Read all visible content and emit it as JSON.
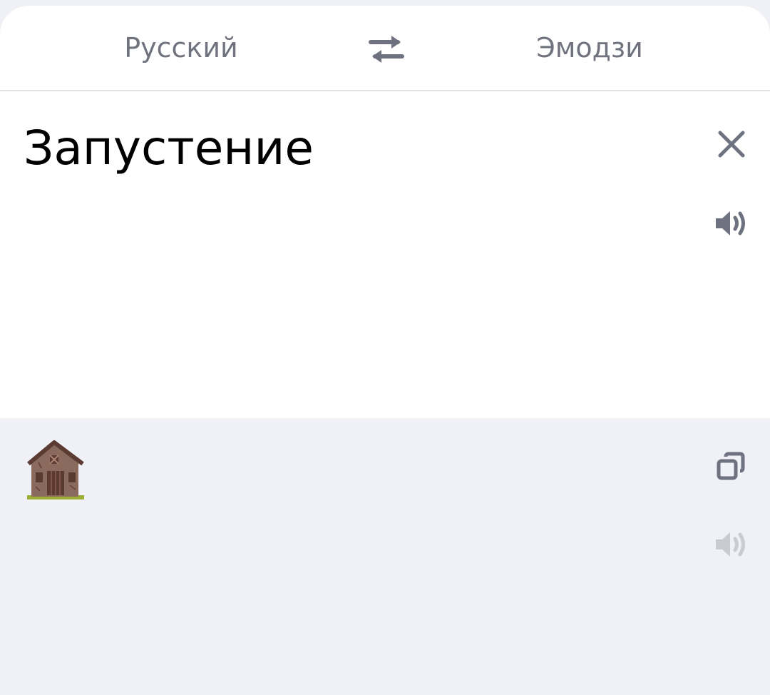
{
  "languages": {
    "source": "Русский",
    "target": "Эмодзи"
  },
  "input": {
    "text": "Запустение"
  },
  "output": {
    "text": "🏚️"
  },
  "icons": {
    "swap": "swap-arrows-icon",
    "clear": "close-icon",
    "speak_source": "speaker-icon",
    "copy": "copy-icon",
    "speak_result": "speaker-icon"
  },
  "colors": {
    "icon": "#6e7280",
    "icon_disabled": "#c9cbd2",
    "result_bg": "#f0f1f6"
  }
}
